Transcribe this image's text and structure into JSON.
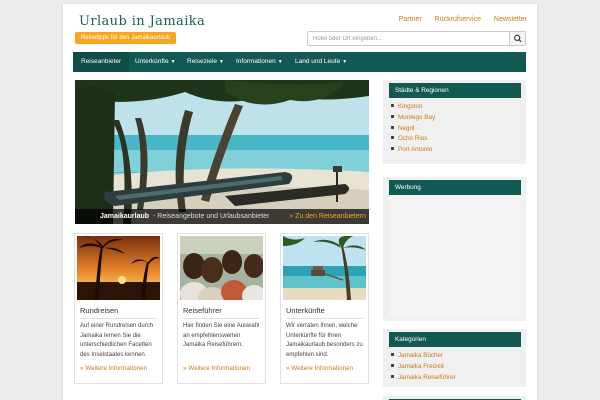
{
  "site": {
    "title": "Urlaub in Jamaika",
    "tagline": "Reisetipps für den Jamaikaurlaub"
  },
  "toplinks": [
    "Partner",
    "Rückrufservice",
    "Newsletter"
  ],
  "search": {
    "placeholder": "Hotel oder Ort eingeben...",
    "icon": "search-icon"
  },
  "nav": [
    {
      "label": "Reiseanbieter",
      "dropdown": false
    },
    {
      "label": "Unterkünfte",
      "dropdown": true
    },
    {
      "label": "Reiseziele",
      "dropdown": true
    },
    {
      "label": "Informationen",
      "dropdown": true
    },
    {
      "label": "Land und Leute",
      "dropdown": true
    }
  ],
  "slider": {
    "title": "Jamaikaurlaub",
    "subtitle": "- Reiseangebote und Urlaubsanbieter",
    "link": "» Zu den Reiseanbietern"
  },
  "cards": [
    {
      "title": "Rundreisen",
      "text": "Auf einer Rundreisen durch Jamaika lernen Sie die unterschiedlichen Facetten des Inselstaates kennen.",
      "more": "» Weitere Informationen"
    },
    {
      "title": "Reiseführer",
      "text": "Hier finden Sie eine Auswahl an empfehlenswerten Jamaika Reiseführern.",
      "more": "» Weitere Informationen"
    },
    {
      "title": "Unterkünfte",
      "text": "Wir verraten Ihnen, welche Unterkünfte für Ihren Jamaikaurlaub besonders zu empfehlen sind.",
      "more": "» Weitere Informationen"
    }
  ],
  "sidebar": {
    "cities": {
      "heading": "Städte & Regionen",
      "items": [
        "Kingston",
        "Montego Bay",
        "Negril",
        "Ocho Rios",
        "Port Antonio"
      ]
    },
    "ads": {
      "heading": "Werbung"
    },
    "categories": {
      "heading": "Kategorien",
      "items": [
        "Jamaika Bücher",
        "Jamaika Freizeit",
        "Jamaika Reiseführer"
      ]
    }
  },
  "colors": {
    "accent_green": "#125952",
    "accent_orange": "#f5a623",
    "link": "#c97a18",
    "background": "#ececec"
  }
}
